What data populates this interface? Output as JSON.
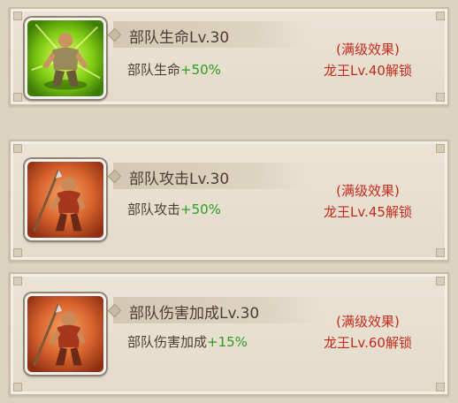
{
  "rows": [
    {
      "title": "部队生命Lv.30",
      "effect_name": "部队生命",
      "effect_bonus": "+50%",
      "max_label": "(满级效果)",
      "unlock": "龙王Lv.40解锁",
      "icon": "soldier-green-icon"
    },
    {
      "title": "部队攻击Lv.30",
      "effect_name": "部队攻击",
      "effect_bonus": "+50%",
      "max_label": "(满级效果)",
      "unlock": "龙王Lv.45解锁",
      "icon": "spearman-red-icon"
    },
    {
      "title": "部队伤害加成Lv.30",
      "effect_name": "部队伤害加成",
      "effect_bonus": "+15%",
      "max_label": "(满级效果)",
      "unlock": "龙王Lv.60解锁",
      "icon": "spearman-red-icon"
    }
  ],
  "colors": {
    "bonus_green": "#2f9a24",
    "unlock_red": "#c42a1f",
    "text_dark": "#4a3f33"
  }
}
